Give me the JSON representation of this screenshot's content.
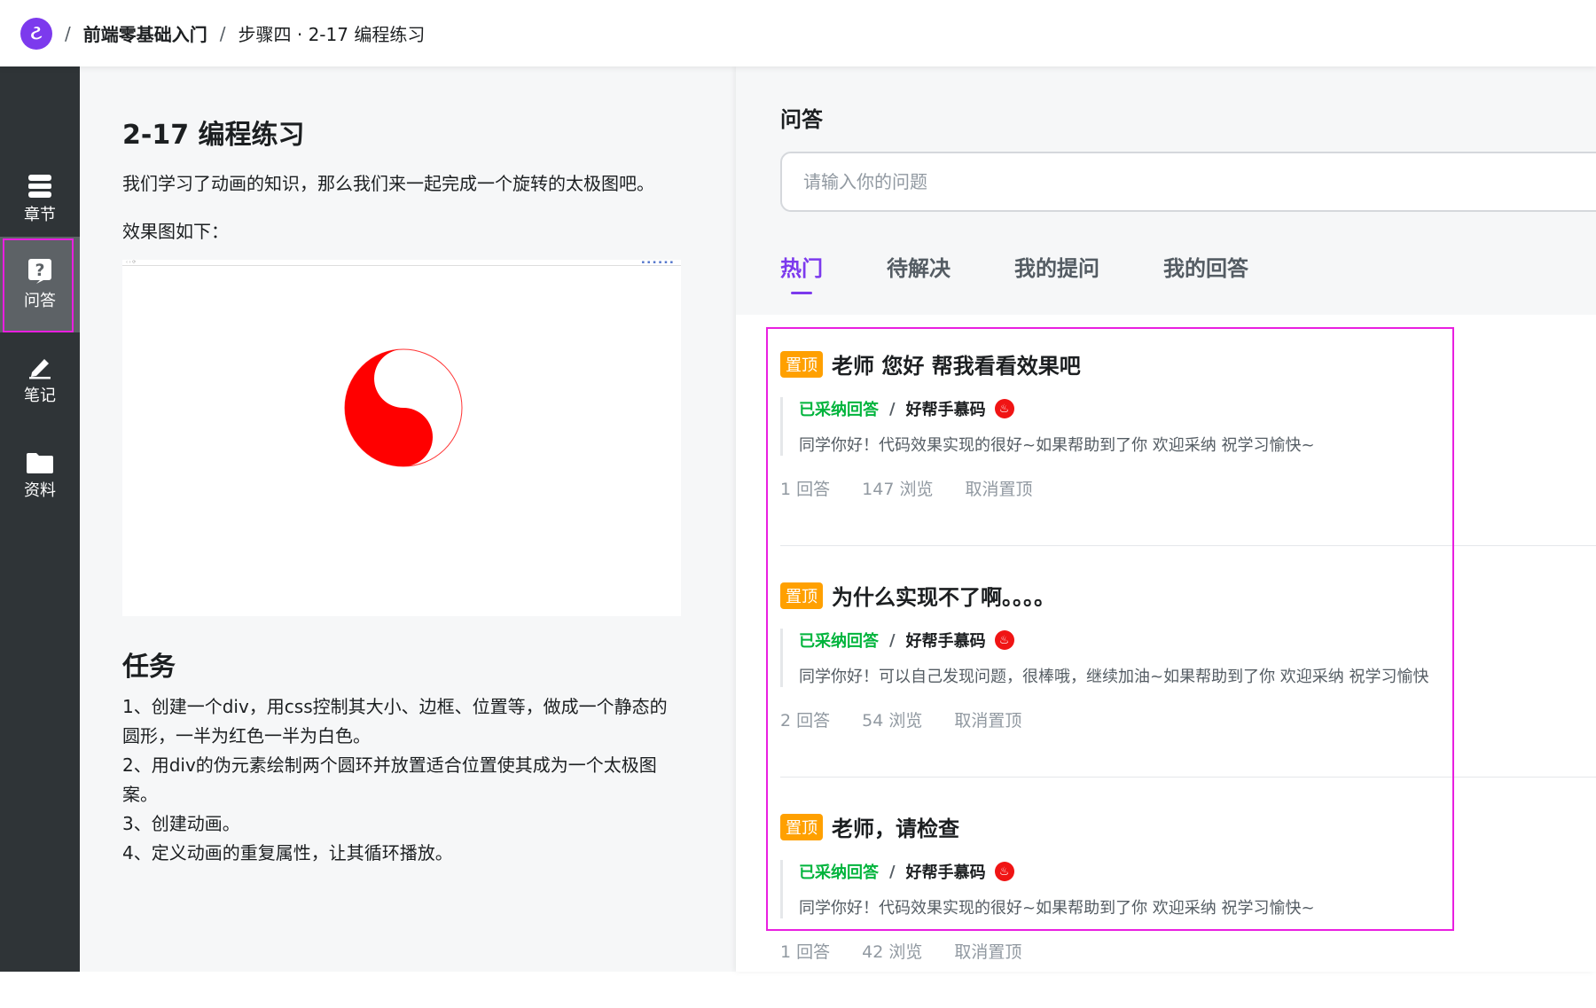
{
  "topbar": {
    "logo_glyph": "ટ",
    "course": "前端零基础入门",
    "step": "步骤四 · 2-17 编程练习",
    "separator": "/"
  },
  "sidebar": {
    "items": [
      {
        "label": "章节",
        "icon": "chapter-list-icon"
      },
      {
        "label": "问答",
        "icon": "question-icon"
      },
      {
        "label": "笔记",
        "icon": "pen-icon"
      },
      {
        "label": "资料",
        "icon": "folder-icon"
      }
    ],
    "active": "问答"
  },
  "lesson": {
    "title": "2-17 编程练习",
    "intro": "我们学习了动画的知识，那么我们来一起完成一个旋转的太极图吧。",
    "preview_label": "效果图如下：",
    "task_title": "任务",
    "tasks": [
      "1、创建一个div，用css控制其大小、边框、位置等，做成一个静态的圆形，一半为红色一半为白色。",
      "2、用div的伪元素绘制两个圆环并放置适合位置使其成为一个太极图案。",
      "3、创建动画。",
      "4、定义动画的重复属性，让其循环播放。"
    ]
  },
  "qa": {
    "title": "问答",
    "search_placeholder": "请输入你的问题",
    "tabs": [
      "热门",
      "待解决",
      "我的提问",
      "我的回答"
    ],
    "active_tab": "热门",
    "questions": [
      {
        "badge": "置顶",
        "title": "老师 您好 帮我看看效果吧",
        "accepted_label": "已采纳回答",
        "answerer": "好帮手慕码",
        "answer": "同学你好！代码效果实现的很好~如果帮助到了你 欢迎采纳 祝学习愉快~",
        "answers": "1 回答",
        "views": "147 浏览",
        "action": "取消置顶"
      },
      {
        "badge": "置顶",
        "title": "为什么实现不了啊。。。。",
        "accepted_label": "已采纳回答",
        "answerer": "好帮手慕码",
        "answer": "同学你好！可以自己发现问题，很棒哦，继续加油~如果帮助到了你 欢迎采纳 祝学习愉快",
        "answers": "2 回答",
        "views": "54 浏览",
        "action": "取消置顶"
      },
      {
        "badge": "置顶",
        "title": "老师，请检查",
        "accepted_label": "已采纳回答",
        "answerer": "好帮手慕码",
        "answer": "同学你好！代码效果实现的很好~如果帮助到了你 欢迎采纳 祝学习愉快~",
        "answers": "1 回答",
        "views": "42 浏览",
        "action": "取消置顶"
      }
    ]
  },
  "colors": {
    "brand": "#7c3aed",
    "sidebar_bg": "#2f3437",
    "accepted": "#00b43c",
    "badge": "#ffa000",
    "highlight": "#e91fe0",
    "taiji_red": "#ff0000"
  }
}
